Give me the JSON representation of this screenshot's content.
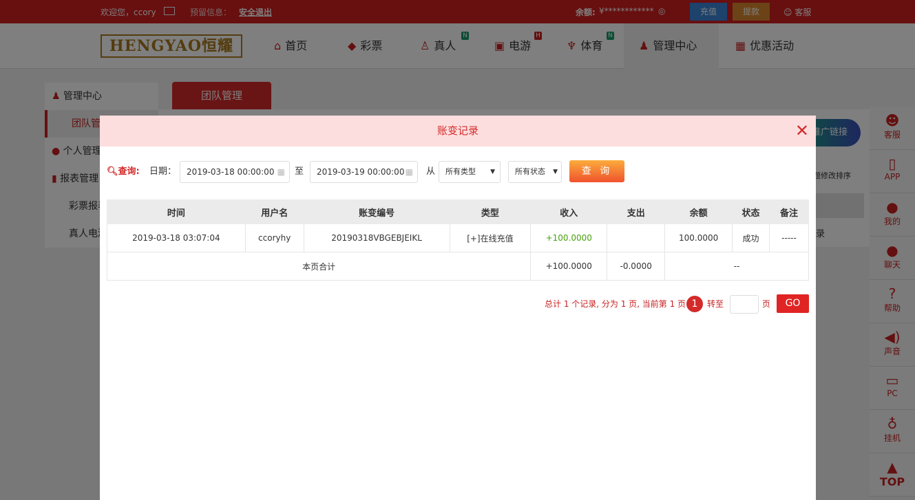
{
  "topbar": {
    "welcome": "欢迎您，ccory",
    "mail_icon": "envelope-icon",
    "reserved": "预留信息：",
    "logout": "安全退出",
    "balance_label": "余额:",
    "balance": "¥************",
    "recharge": "充值",
    "withdraw": "提款",
    "service": "客服"
  },
  "nav": {
    "logo": "HENGYAO恒耀",
    "items": [
      {
        "label": "首页",
        "icon": "home-icon"
      },
      {
        "label": "彩票",
        "icon": "ticket-icon"
      },
      {
        "label": "真人",
        "icon": "dealer-icon",
        "badge": "N"
      },
      {
        "label": "电游",
        "icon": "slot-icon",
        "badge": "H"
      },
      {
        "label": "体育",
        "icon": "trophy-icon",
        "badge": "N"
      },
      {
        "label": "管理中心",
        "icon": "users-icon"
      },
      {
        "label": "优惠活动",
        "icon": "gift-icon"
      }
    ]
  },
  "sidebar": {
    "items": [
      "管理中心",
      "团队管理",
      "个人管理",
      "报表管理",
      "彩票报表",
      "真人电游"
    ]
  },
  "tab": "团队管理",
  "bg": {
    "promo": "推广链接",
    "sort_hint": "标题修改排序",
    "record": "录"
  },
  "rail": [
    {
      "label": "客服",
      "icon": "headset-icon"
    },
    {
      "label": "APP",
      "icon": "phone-icon"
    },
    {
      "label": "我的",
      "icon": "user-icon"
    },
    {
      "label": "聊天",
      "icon": "chat-icon"
    },
    {
      "label": "帮助",
      "icon": "help-icon"
    },
    {
      "label": "声音",
      "icon": "speaker-icon"
    },
    {
      "label": "PC",
      "icon": "monitor-icon"
    },
    {
      "label": "挂机",
      "icon": "bag-icon"
    },
    {
      "label": "TOP",
      "icon": "up-arrow-icon"
    }
  ],
  "modal": {
    "title": "账变记录",
    "query": "查询:",
    "date_label": "日期：",
    "start": "2019-03-18 00:00:00",
    "to": "至",
    "end": "2019-03-19 00:00:00",
    "from": "从",
    "type": "所有类型",
    "status": "所有状态",
    "search": "查 询",
    "columns": [
      "时间",
      "用户名",
      "账变编号",
      "类型",
      "收入",
      "支出",
      "余额",
      "状态",
      "备注"
    ],
    "rows": [
      [
        "2019-03-18 03:07:04",
        "ccoryhy",
        "20190318VBGEBJEIKL",
        "[+]在线充值",
        "+100.0000",
        "",
        "100.0000",
        "成功",
        "-----"
      ]
    ],
    "total": {
      "label": "本页合计",
      "income": "+100.0000",
      "expense": "-0.0000",
      "rest": "--"
    },
    "pager": {
      "summary": "总计 1 个记录, 分为 1 页, 当前第 1 页",
      "page": "1",
      "goto": "转至",
      "page_unit": "页",
      "go": "GO",
      "input": ""
    }
  }
}
